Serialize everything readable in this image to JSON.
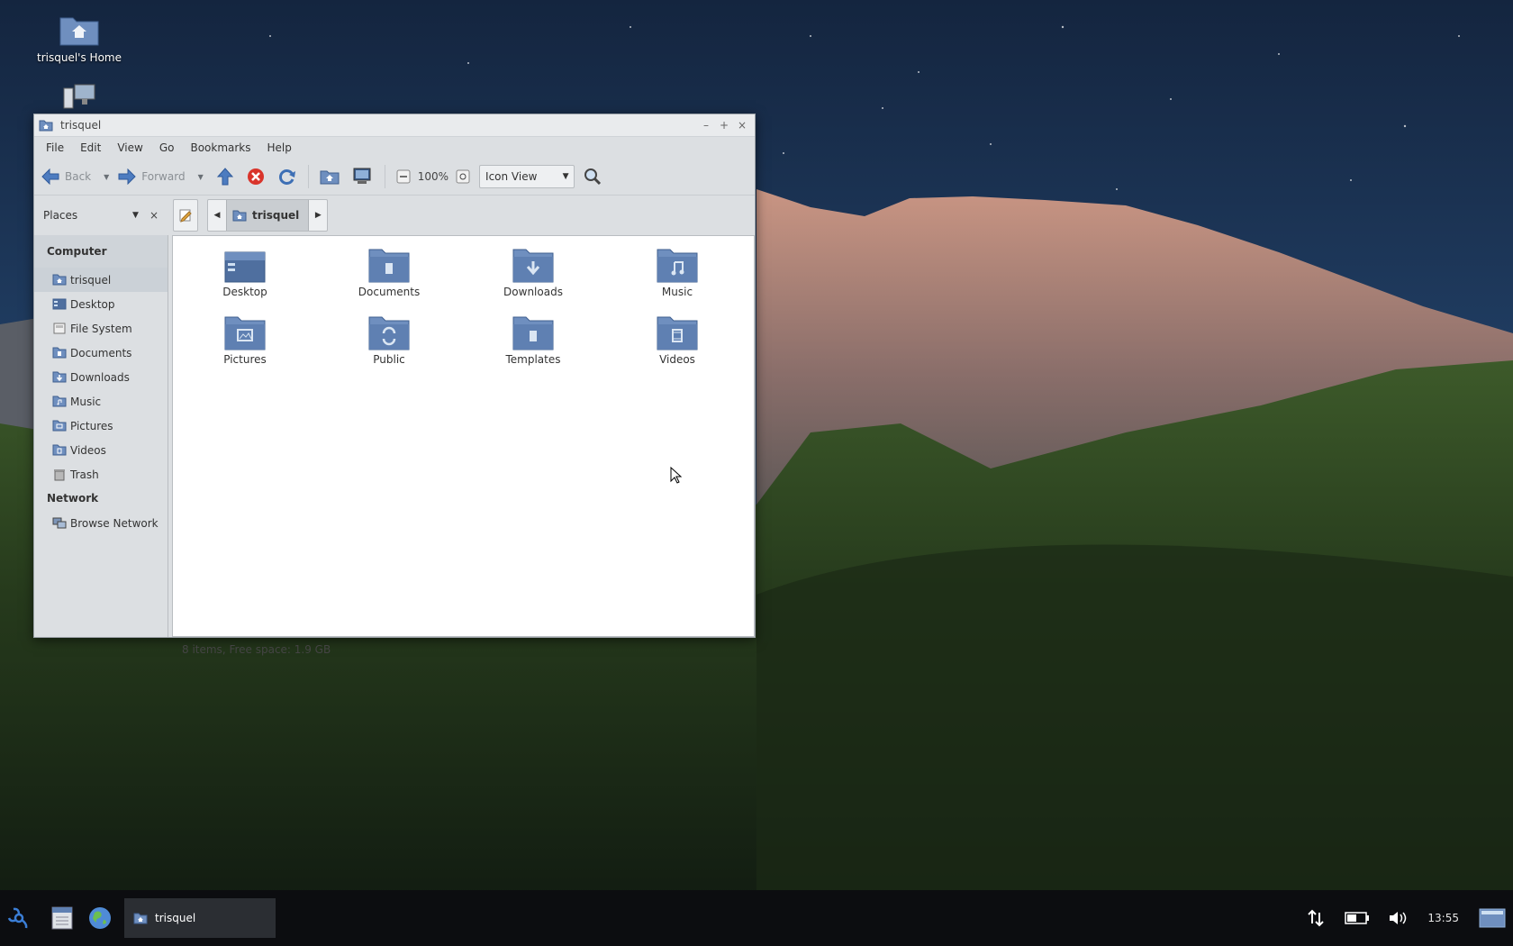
{
  "desktop": {
    "icons": [
      {
        "label": "trisquel's Home",
        "icon": "home-folder-icon"
      },
      {
        "label": "",
        "icon": "computer-icon"
      }
    ]
  },
  "window": {
    "title": "trisquel",
    "menu": [
      "File",
      "Edit",
      "View",
      "Go",
      "Bookmarks",
      "Help"
    ],
    "toolbar": {
      "back_label": "Back",
      "forward_label": "Forward",
      "zoom": "100%",
      "view_mode": "Icon View"
    },
    "places": {
      "label": "Places",
      "close": "×"
    },
    "breadcrumb": {
      "current": "trisquel"
    },
    "sidebar": {
      "section_computer": "Computer",
      "section_network": "Network",
      "items": [
        {
          "label": "trisquel",
          "icon": "home-folder-icon",
          "selected": true
        },
        {
          "label": "Desktop",
          "icon": "desktop-icon"
        },
        {
          "label": "File System",
          "icon": "filesystem-icon"
        },
        {
          "label": "Documents",
          "icon": "documents-folder-icon"
        },
        {
          "label": "Downloads",
          "icon": "downloads-folder-icon"
        },
        {
          "label": "Music",
          "icon": "music-folder-icon"
        },
        {
          "label": "Pictures",
          "icon": "pictures-folder-icon"
        },
        {
          "label": "Videos",
          "icon": "videos-folder-icon"
        },
        {
          "label": "Trash",
          "icon": "trash-icon"
        }
      ],
      "network_items": [
        {
          "label": "Browse Network",
          "icon": "network-icon"
        }
      ]
    },
    "files": [
      {
        "name": "Desktop",
        "icon": "desktop-folder-icon"
      },
      {
        "name": "Documents",
        "icon": "documents-folder-icon"
      },
      {
        "name": "Downloads",
        "icon": "downloads-folder-icon"
      },
      {
        "name": "Music",
        "icon": "music-folder-icon"
      },
      {
        "name": "Pictures",
        "icon": "pictures-folder-icon"
      },
      {
        "name": "Public",
        "icon": "public-folder-icon"
      },
      {
        "name": "Templates",
        "icon": "templates-folder-icon"
      },
      {
        "name": "Videos",
        "icon": "videos-folder-icon"
      }
    ],
    "status": "8 items, Free space: 1.9 GB"
  },
  "taskbar": {
    "task_label": "trisquel",
    "clock": "13:55"
  },
  "colors": {
    "folder": "#6f8fbf",
    "folder_dark": "#4f6f9f",
    "taskbar": "#0c0d10"
  }
}
